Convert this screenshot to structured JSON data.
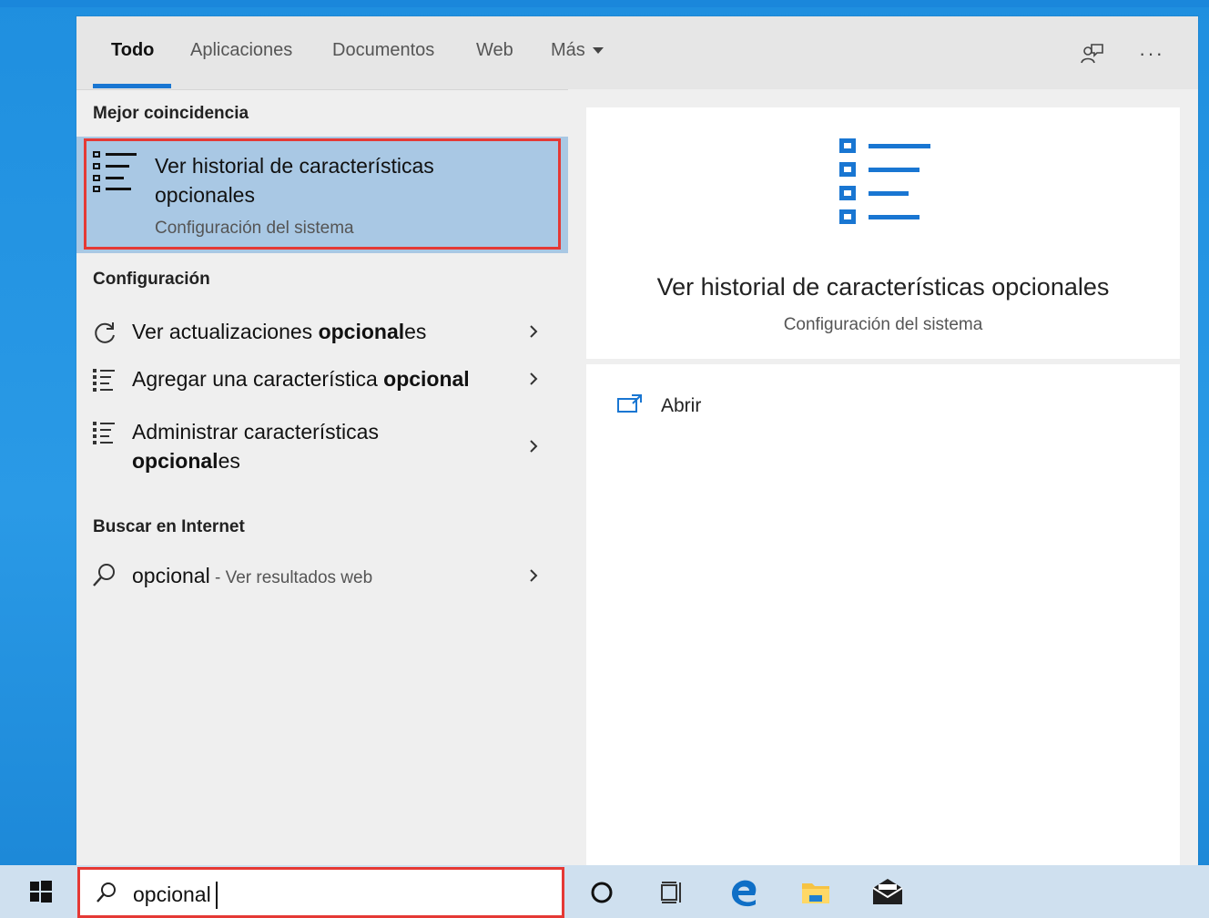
{
  "tabs": [
    {
      "label": "Todo",
      "active": true
    },
    {
      "label": "Aplicaciones"
    },
    {
      "label": "Documentos"
    },
    {
      "label": "Web"
    },
    {
      "label": "Más"
    }
  ],
  "tabbar_icons": [
    "feedback-icon",
    "more-options-icon"
  ],
  "more_label": "···",
  "left": {
    "best_match_heading": "Mejor coincidencia",
    "best_match": {
      "title": "Ver historial de características opcionales",
      "subtitle": "Configuración del sistema",
      "icon": "list-icon"
    },
    "settings_heading": "Configuración",
    "settings_items": [
      {
        "pre": "Ver actualizaciones ",
        "bold": "opcional",
        "post": "es",
        "icon": "refresh-icon"
      },
      {
        "pre": "Agregar una característica ",
        "bold": "opcional",
        "post": "",
        "icon": "list-icon"
      },
      {
        "pre": "Administrar características ",
        "bold": "opcional",
        "post": "es",
        "icon": "list-icon"
      }
    ],
    "web_heading": "Buscar en Internet",
    "web_item": {
      "query": "opcional",
      "suffix": " - Ver resultados web",
      "icon": "search-icon"
    }
  },
  "preview": {
    "title": "Ver historial de características opcionales",
    "subtitle": "Configuración del sistema",
    "action_open": "Abrir"
  },
  "taskbar": {
    "search_value": "opcional",
    "icons": [
      "windows-start-icon",
      "cortana-icon",
      "task-view-icon",
      "edge-icon",
      "file-explorer-icon",
      "mail-icon"
    ]
  },
  "colors": {
    "accent": "#1976d2",
    "highlight": "#a9c8e4",
    "outline_red": "#e53935",
    "taskbar": "#cfe0ef"
  }
}
